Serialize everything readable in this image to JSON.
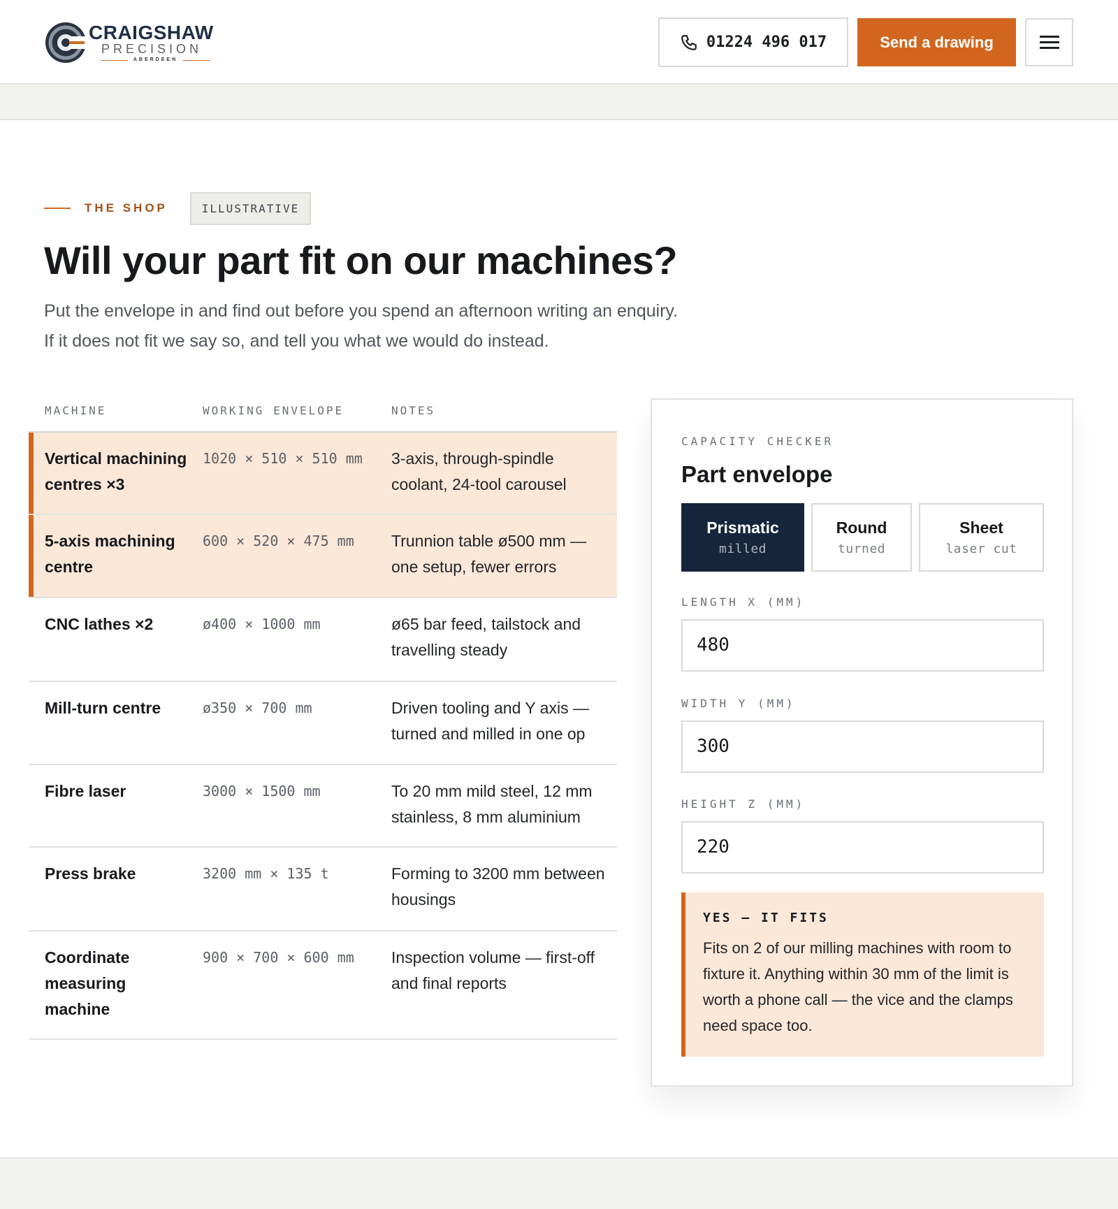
{
  "header": {
    "brand": {
      "name": "CRAIGSHAW",
      "sub": "PRECISION",
      "location": "ABERDEEN"
    },
    "phone": "01224 496 017",
    "cta_label": "Send a drawing",
    "menu_icon": "hamburger-menu-icon"
  },
  "intro": {
    "eyebrow": "THE SHOP",
    "tag": "ILLUSTRATIVE",
    "title": "Will your part fit on our machines?",
    "lede_line1": "Put the envelope in and find out before you spend an afternoon writing an enquiry.",
    "lede_line2": "If it does not fit we say so, and tell you what we would do instead."
  },
  "machines": {
    "columns": [
      "MACHINE",
      "WORKING ENVELOPE",
      "NOTES"
    ],
    "rows": [
      {
        "name": "Vertical machining centres ×3",
        "envelope": "1020 × 510 × 510 mm",
        "notes": "3-axis, through-spindle coolant, 24-tool carousel",
        "highlighted": true
      },
      {
        "name": "5-axis machining centre",
        "envelope": "600 × 520 × 475 mm",
        "notes": "Trunnion table ø500 mm — one setup, fewer errors",
        "highlighted": true
      },
      {
        "name": "CNC lathes ×2",
        "envelope": "ø400 × 1000 mm",
        "notes": "ø65 bar feed, tailstock and travelling steady",
        "highlighted": false
      },
      {
        "name": "Mill-turn centre",
        "envelope": "ø350 × 700 mm",
        "notes": "Driven tooling and Y axis — turned and milled in one op",
        "highlighted": false
      },
      {
        "name": "Fibre laser",
        "envelope": "3000 × 1500 mm",
        "notes": "To 20 mm mild steel, 12 mm stainless, 8 mm aluminium",
        "highlighted": false
      },
      {
        "name": "Press brake",
        "envelope": "3200 mm × 135 t",
        "notes": "Forming to 3200 mm between housings",
        "highlighted": false
      },
      {
        "name": "Coordinate measuring machine",
        "envelope": "900 × 700 × 600 mm",
        "notes": "Inspection volume — first-off and final reports",
        "highlighted": false
      }
    ]
  },
  "checker": {
    "eyebrow": "CAPACITY CHECKER",
    "title": "Part envelope",
    "segments": [
      {
        "title": "Prismatic",
        "sub": "milled",
        "active": true
      },
      {
        "title": "Round",
        "sub": "turned",
        "active": false
      },
      {
        "title": "Sheet",
        "sub": "laser cut",
        "active": false
      }
    ],
    "fields": [
      {
        "label": "LENGTH X (MM)",
        "value": "480"
      },
      {
        "label": "WIDTH Y (MM)",
        "value": "300"
      },
      {
        "label": "HEIGHT Z (MM)",
        "value": "220"
      }
    ],
    "result": {
      "heading": "YES — IT FITS",
      "body": "Fits on 2 of our milling machines with room to fixture it. Anything within 30 mm of the limit is worth a phone call — the vice and the clamps need space too."
    }
  },
  "colors": {
    "accent": "#d3661f",
    "navy": "#15253b",
    "highlight": "#fbe8d9",
    "band": "#f2f2ee"
  }
}
